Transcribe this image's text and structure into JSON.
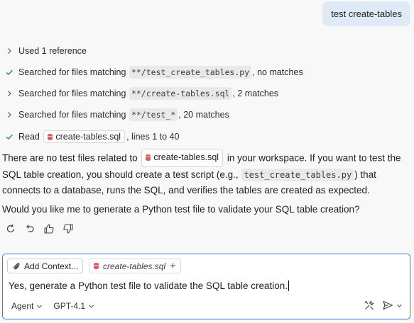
{
  "user_message": "test create-tables",
  "steps": [
    {
      "icon": "chevron-right-icon",
      "prefix": "Used 1 reference",
      "chip": "",
      "suffix": ""
    },
    {
      "icon": "check-icon",
      "prefix": "Searched for files matching",
      "chip": "**/test_create_tables.py",
      "suffix": ", no matches"
    },
    {
      "icon": "chevron-right-icon",
      "prefix": "Searched for files matching",
      "chip": "**/create-tables.sql",
      "suffix": ", 2 matches"
    },
    {
      "icon": "chevron-right-icon",
      "prefix": "Searched for files matching",
      "chip": "**/test_*",
      "suffix": ", 20 matches"
    },
    {
      "icon": "check-icon",
      "prefix": "Read",
      "file": "create-tables.sql",
      "suffix": ", lines 1 to 40"
    }
  ],
  "answer": {
    "part1": "There are no test files related to",
    "file": "create-tables.sql",
    "part2": "in your workspace. If you want to test the SQL table creation, you should create a test script (e.g.,",
    "code": "test_create_tables.py",
    "part3": ") that connects to a database, runs the SQL, and verifies the tables are created as expected."
  },
  "question": "Would you like me to generate a Python test file to validate your SQL table creation?",
  "composer": {
    "add_context_label": "Add Context...",
    "context_file": "create-tables.sql",
    "input_value": "Yes, generate a Python test file to validate the SQL table creation.",
    "mode": "Agent",
    "model": "GPT-4.1"
  },
  "colors": {
    "accent": "#3a7bd5",
    "check": "#2e8b57",
    "user_bubble": "#dfeaf7"
  }
}
